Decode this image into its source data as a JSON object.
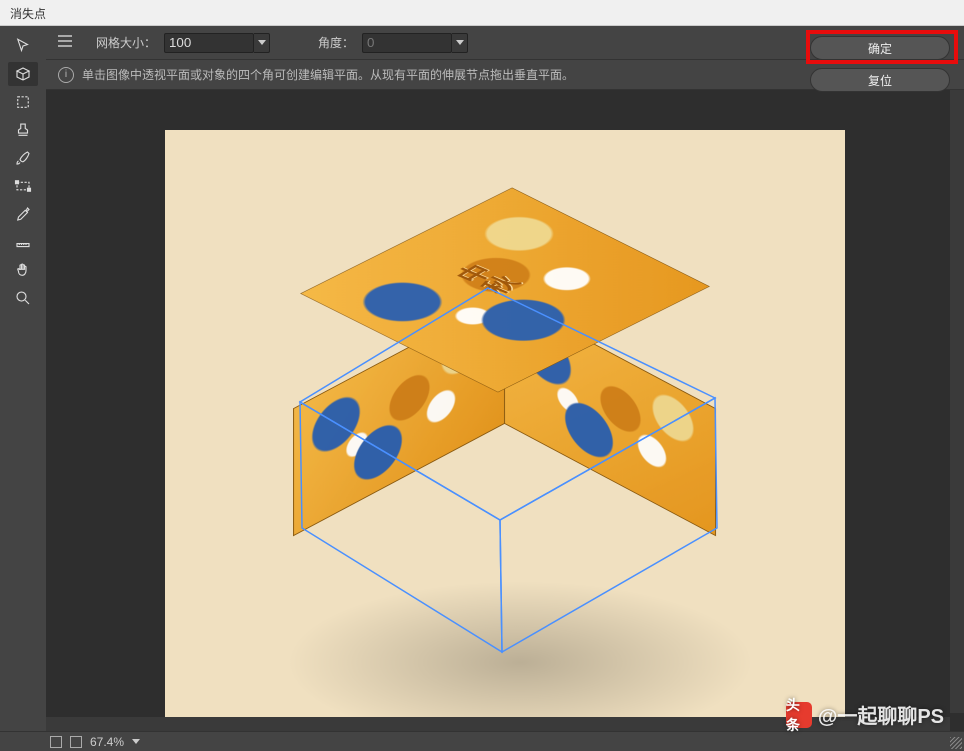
{
  "window": {
    "title": "消失点"
  },
  "options": {
    "grid_label": "网格大小：",
    "grid_value": "100",
    "angle_label": "角度：",
    "angle_value": "0"
  },
  "info": {
    "hint": "单击图像中透视平面或对象的四个角可创建编辑平面。从现有平面的伸展节点拖出垂直平面。"
  },
  "buttons": {
    "ok": "确定",
    "reset": "复位"
  },
  "tools": [
    {
      "name": "pointer-tool",
      "icon": "pointer"
    },
    {
      "name": "create-plane-tool",
      "icon": "grid"
    },
    {
      "name": "marquee-tool",
      "icon": "marquee"
    },
    {
      "name": "stamp-tool",
      "icon": "stamp"
    },
    {
      "name": "brush-tool",
      "icon": "brush"
    },
    {
      "name": "transform-tool",
      "icon": "transform"
    },
    {
      "name": "eyedropper-tool",
      "icon": "eyedropper"
    },
    {
      "name": "measure-tool",
      "icon": "measure"
    },
    {
      "name": "hand-tool",
      "icon": "hand"
    },
    {
      "name": "zoom-tool",
      "icon": "zoom"
    }
  ],
  "canvas": {
    "box_text": "中秋"
  },
  "status": {
    "zoom": "67.4%"
  },
  "watermark": {
    "prefix": "头条",
    "text": "@一起聊聊PS"
  }
}
